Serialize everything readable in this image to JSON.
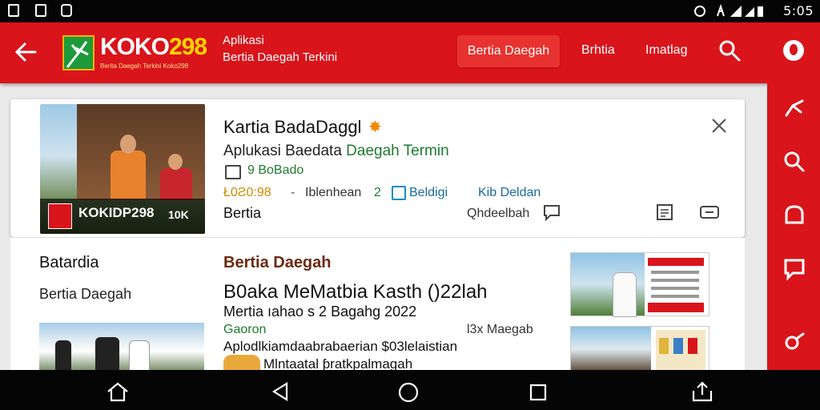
{
  "status_bar": {
    "time": "5:05"
  },
  "app_bar": {
    "logo_text_prefix": "KOKO",
    "logo_text_number": "298",
    "logo_tagline": "Berita Daegah Terkini Koko298",
    "subtitle_line1": "Aplikasi",
    "subtitle_line2": "Bertia Daegah Terkini",
    "nav_active": "Bertia Daegah",
    "nav_items": [
      "Brhtia",
      "Imatlag"
    ]
  },
  "card1": {
    "thumb_caption": "KOKIDP298",
    "thumb_count": "10K",
    "title": "Kartia BadaDaggl",
    "subtitle_a": "Aplukasi Baedata ",
    "subtitle_b": "Daegah Termin",
    "source": "9 BoBado",
    "date": "Ł0Ƨ0:98",
    "dash": "-",
    "meta_a": "Iblenhean",
    "meta_num": "2",
    "tag": "Beldigi",
    "author": "Kib Deldan",
    "category": "Bertia",
    "comment": "Qhdeelbah"
  },
  "card2": {
    "side_heading": "Batardia",
    "side_sub": "Bertia Daegah",
    "section": "Bertia Daegah",
    "headline": "B0aka MeMatbia Kasth ()22lah",
    "date_line": "Mertia ıahao s 2 Bagahg 2022",
    "source": "Gaoron",
    "views": "l3x Maegab",
    "summary": "Aplodlkiamdaabrabaerian $03lelaistian",
    "summary2": "Mlntaatal ƥratkpalmagah"
  },
  "colors": {
    "primary_red": "#d9141b",
    "accent_yellow": "#ffd400",
    "accent_green": "#1d9a3a"
  }
}
